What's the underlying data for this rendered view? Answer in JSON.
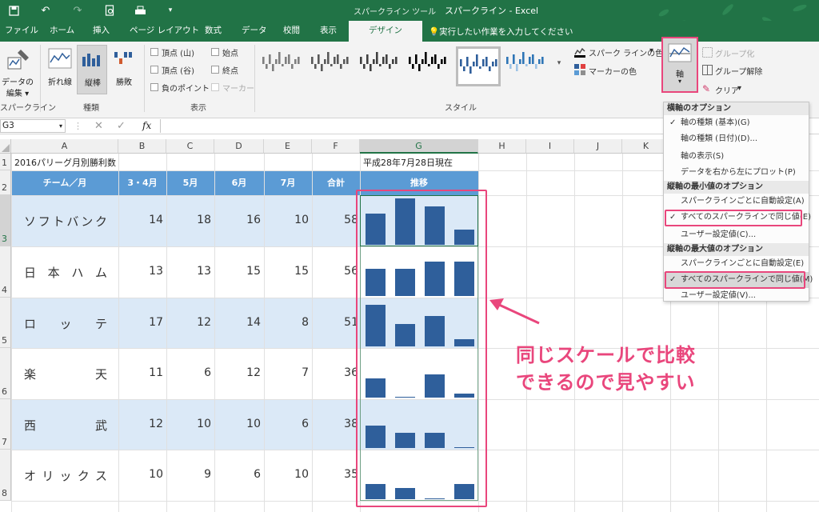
{
  "window": {
    "context_tool": "スパークライン ツール",
    "title": "スパークライン - Excel"
  },
  "tabs": [
    "ファイル",
    "ホーム",
    "挿入",
    "ページ レイアウト",
    "数式",
    "データ",
    "校閲",
    "表示",
    "デザイン"
  ],
  "active_tab": "デザイン",
  "tell_me": "実行したい作業を入力してください",
  "ribbon": {
    "sparkline_group": {
      "button": "データの",
      "button2": "編集",
      "name": "スパークライン"
    },
    "type_group": {
      "line": "折れ線",
      "column": "縦棒",
      "winloss": "勝敗",
      "name": "種類"
    },
    "show_group": {
      "high": "頂点 (山)",
      "low": "頂点 (谷)",
      "negative": "負のポイント",
      "first": "始点",
      "last": "終点",
      "markers": "マーカー",
      "name": "表示"
    },
    "style_group": {
      "sparkline_color": "スパーク ラインの色",
      "marker_color": "マーカーの色",
      "name": "スタイル"
    },
    "axis_button": "軸",
    "group_btn": "グループ化",
    "ungroup_btn": "グループ解除",
    "clear_btn": "クリア"
  },
  "formula_bar": {
    "name_box": "G3",
    "fx": "fx"
  },
  "columns": [
    "A",
    "B",
    "C",
    "D",
    "E",
    "F",
    "G",
    "H",
    "I",
    "J",
    "K"
  ],
  "rows": [
    "1",
    "2",
    "3",
    "4",
    "5",
    "6",
    "7",
    "8"
  ],
  "sheet": {
    "a1": "2016パリーグ月別勝利数",
    "g1": "平成28年7月28日現在",
    "headers": [
      "チーム／月",
      "3・4月",
      "5月",
      "6月",
      "7月",
      "合計",
      "推移"
    ],
    "teams": [
      {
        "name": [
          "ソ",
          "フ",
          "ト",
          "バ",
          "ン",
          "ク"
        ],
        "values": [
          14,
          18,
          16,
          10
        ],
        "total": "58"
      },
      {
        "name": [
          "日",
          "本",
          "ハ",
          "ム"
        ],
        "values": [
          13,
          13,
          15,
          15
        ],
        "total": "56"
      },
      {
        "name": [
          "ロ",
          "ッ",
          "テ"
        ],
        "values": [
          17,
          12,
          14,
          8
        ],
        "total": "51"
      },
      {
        "name": [
          "楽",
          "天"
        ],
        "values": [
          11,
          6,
          12,
          7
        ],
        "total": "36"
      },
      {
        "name": [
          "西",
          "武"
        ],
        "values": [
          12,
          10,
          10,
          6
        ],
        "total": "38"
      },
      {
        "name": [
          "オ",
          "リ",
          "ッ",
          "ク",
          "ス"
        ],
        "values": [
          10,
          9,
          6,
          10
        ],
        "total": "35"
      }
    ],
    "sparkline_axis": {
      "min": 6,
      "max": 18
    }
  },
  "axis_menu": {
    "h_head": "横軸のオプション",
    "h_items": [
      "軸の種類 (基本)(G)",
      "軸の種類 (日付)(D)...",
      "軸の表示(S)",
      "データを右から左にプロット(P)"
    ],
    "vmin_head": "縦軸の最小値のオプション",
    "vmin_items": [
      "スパークラインごとに自動設定(A)",
      "すべてのスパークラインで同じ値(E)",
      "ユーザー設定値(C)..."
    ],
    "vmax_head": "縦軸の最大値のオプション",
    "vmax_items": [
      "スパークラインごとに自動設定(E)",
      "すべてのスパークラインで同じ値(M)",
      "ユーザー設定値(V)..."
    ]
  },
  "annotation": {
    "line1": "同じスケールで比較",
    "line2": "できるので見やすい"
  },
  "colors": {
    "excel_green": "#217346",
    "header_blue": "#5b9bd5",
    "band_blue": "#dbe9f7",
    "bar_blue": "#2f5f9b",
    "accent_pink": "#e9467c"
  }
}
